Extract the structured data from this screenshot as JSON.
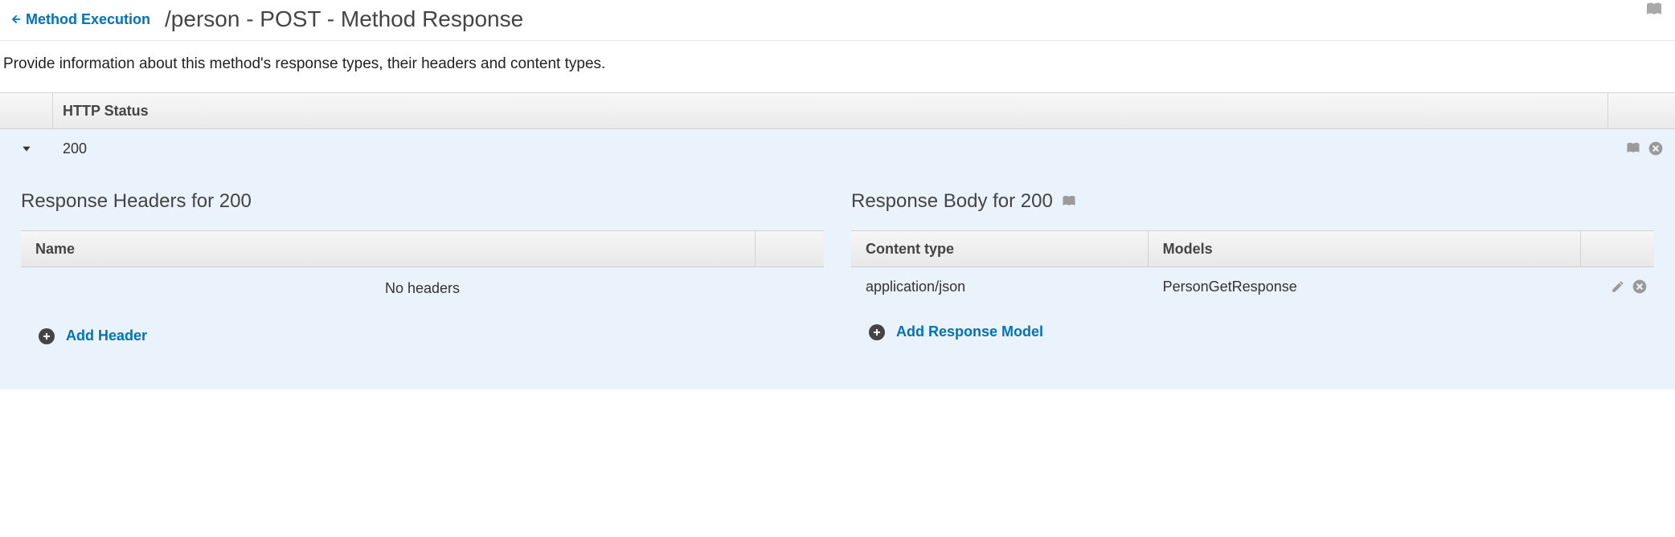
{
  "header": {
    "back_label": "Method Execution",
    "title": "/person - POST - Method Response"
  },
  "description": "Provide information about this method's response types, their headers and content types.",
  "status_table": {
    "header_label": "HTTP Status",
    "rows": [
      {
        "code": "200",
        "expanded": true
      }
    ]
  },
  "headers_panel": {
    "title": "Response Headers for 200",
    "columns": {
      "name": "Name"
    },
    "empty_text": "No headers",
    "add_label": "Add Header"
  },
  "body_panel": {
    "title": "Response Body for 200",
    "columns": {
      "content_type": "Content type",
      "models": "Models"
    },
    "rows": [
      {
        "content_type": "application/json",
        "model": "PersonGetResponse"
      }
    ],
    "add_label": "Add Response Model"
  }
}
